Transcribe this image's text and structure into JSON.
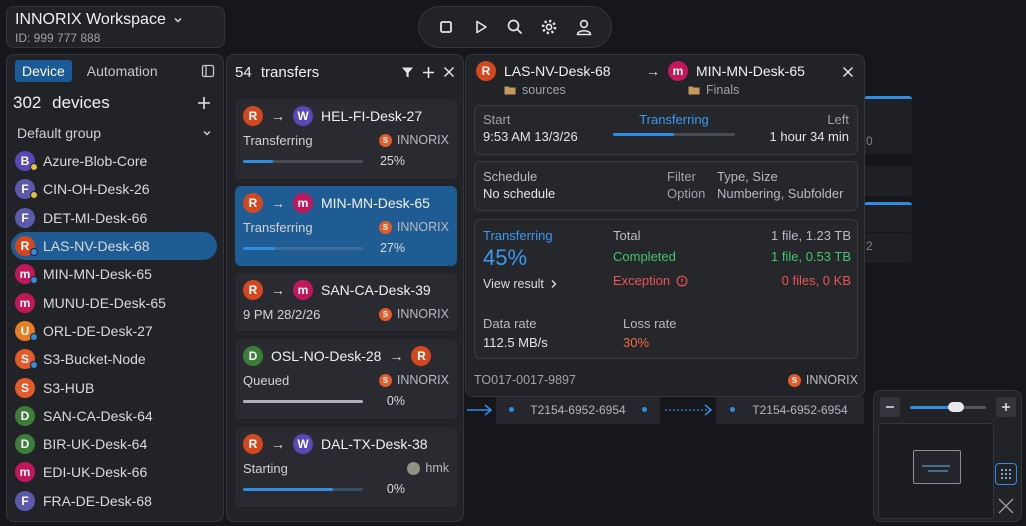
{
  "workspace": {
    "title": "INNORIX Workspace",
    "id_label": "ID: 999 777 888"
  },
  "toolbar": {
    "icons": [
      "stop-icon",
      "play-icon",
      "search-icon",
      "gear-icon",
      "user-icon"
    ]
  },
  "devices_panel": {
    "tabs": [
      "Device",
      "Automation"
    ],
    "count": "302",
    "count_label": "devices",
    "group": "Default group",
    "items": [
      {
        "name": "Azure-Blob-Core",
        "letter": "B",
        "color": "#5a48b8",
        "dot": "#e6c43a"
      },
      {
        "name": "CIN-OH-Desk-26",
        "letter": "F",
        "color": "#5c5aad",
        "dot": "#e6c43a"
      },
      {
        "name": "DET-MI-Desk-66",
        "letter": "F",
        "color": "#5c5aad",
        "dot": ""
      },
      {
        "name": "LAS-NV-Desk-68",
        "letter": "R",
        "color": "#d4481f",
        "dot": "#2f8de4"
      },
      {
        "name": "MIN-MN-Desk-65",
        "letter": "m",
        "color": "#c2185b",
        "dot": "#2f8de4"
      },
      {
        "name": "MUNU-DE-Desk-65",
        "letter": "m",
        "color": "#c2185b",
        "dot": ""
      },
      {
        "name": "ORL-DE-Desk-27",
        "letter": "U",
        "color": "#e87e21",
        "dot": "#2f8de4"
      },
      {
        "name": "S3-Bucket-Node",
        "letter": "S",
        "color": "#e45b2a",
        "dot": "#2f8de4"
      },
      {
        "name": "S3-HUB",
        "letter": "S",
        "color": "#e45b2a",
        "dot": ""
      },
      {
        "name": "SAN-CA-Desk-64",
        "letter": "D",
        "color": "#3c7d3a",
        "dot": ""
      },
      {
        "name": "BIR-UK-Desk-64",
        "letter": "D",
        "color": "#3c7d3a",
        "dot": ""
      },
      {
        "name": "EDI-UK-Desk-66",
        "letter": "m",
        "color": "#c2185b",
        "dot": ""
      },
      {
        "name": "FRA-DE-Desk-68",
        "letter": "F",
        "color": "#5c5aad",
        "dot": ""
      }
    ]
  },
  "transfers_panel": {
    "count": "54",
    "count_label": "transfers",
    "cards": [
      {
        "from": "R",
        "from_color": "#d4481f",
        "to": "W",
        "to_color": "#5a48b8",
        "target": "HEL-FI-Desk-27",
        "status": "Transferring",
        "source": "INNORIX",
        "source_letter": "S",
        "progress": 0.25,
        "pct": "25%",
        "time": ""
      },
      {
        "from": "R",
        "from_color": "#d4481f",
        "to": "m",
        "to_color": "#c2185b",
        "target": "MIN-MN-Desk-65",
        "status": "Transferring",
        "source": "INNORIX",
        "source_letter": "S",
        "progress": 0.27,
        "pct": "27%",
        "time": ""
      },
      {
        "from": "R",
        "from_color": "#d4481f",
        "to": "m",
        "to_color": "#c2185b",
        "target": "SAN-CA-Desk-39",
        "status": "",
        "source": "INNORIX",
        "source_letter": "S",
        "progress": null,
        "pct": "",
        "time": "9 PM 28/2/26"
      },
      {
        "from": "D",
        "from_color": "#3c7d3a",
        "to": "R",
        "to_color": "#d4481f",
        "target": "OSL-NO-Desk-28",
        "status": "Queued",
        "source": "INNORIX",
        "source_letter": "S",
        "progress": 0,
        "pct": "0%",
        "time": ""
      },
      {
        "from": "R",
        "from_color": "#d4481f",
        "to": "W",
        "to_color": "#5a48b8",
        "target": "DAL-TX-Desk-38",
        "status": "Starting",
        "source": "hmk",
        "source_letter": "",
        "progress": 0,
        "pct": "0%",
        "time": ""
      }
    ]
  },
  "detail": {
    "from_name": "LAS-NV-Desk-68",
    "from_folder": "sources",
    "to_name": "MIN-MN-Desk-65",
    "to_folder": "Finals",
    "start_label": "Start",
    "start_value": "9:53 AM 13/3/26",
    "status": "Transferring",
    "progress": 0.5,
    "left_label": "Left",
    "left_value": "1 hour 34 min",
    "schedule_label": "Schedule",
    "schedule_value": "No schedule",
    "filter_label": "Filter",
    "option_label": "Option",
    "type_label": "Type, Size",
    "option_value": "Numbering, Subfolder",
    "stat_status": "Transferring",
    "stat_pct": "45%",
    "view_result": "View result",
    "total_label": "Total",
    "total_value": "1 file, 1.23 TB",
    "completed_label": "Completed",
    "completed_value": "1 file, 0.53 TB",
    "exception_label": "Exception",
    "exception_value": "0 files, 0 KB",
    "rate_label": "Data rate",
    "rate_value": "112.5 MB/s",
    "loss_label": "Loss rate",
    "loss_value": "30%",
    "transfer_id": "TO017-0017-9897",
    "source": "INNORIX"
  },
  "graph": {
    "node1": "T2154-6952-6954",
    "node2": "T2154-6952-6954",
    "ghost1": "0",
    "ghost2": "2"
  },
  "minimap": {
    "zoom": 0.6
  }
}
